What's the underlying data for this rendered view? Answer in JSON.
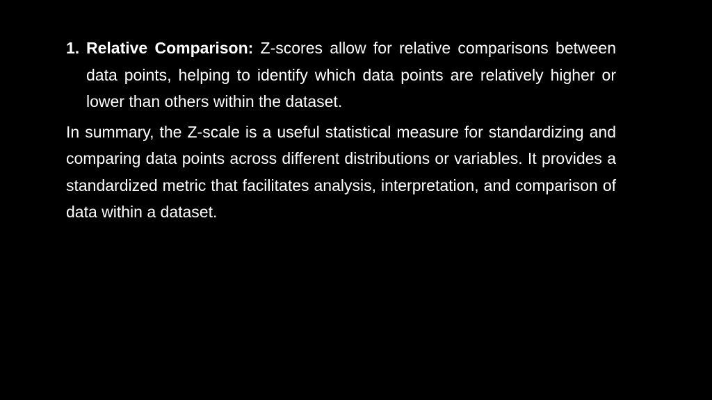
{
  "slide": {
    "list_items": [
      {
        "number": "1.",
        "term": "Relative Comparison:",
        "text": " Z-scores allow for relative comparisons between data points, helping to identify which data points are relatively higher or lower than others within the dataset."
      }
    ],
    "summary": "In summary, the Z-scale is a useful statistical measure for standardizing and comparing data points across different distributions or variables. It provides a standardized metric that facilitates analysis, interpretation, and comparison of data within a dataset."
  }
}
